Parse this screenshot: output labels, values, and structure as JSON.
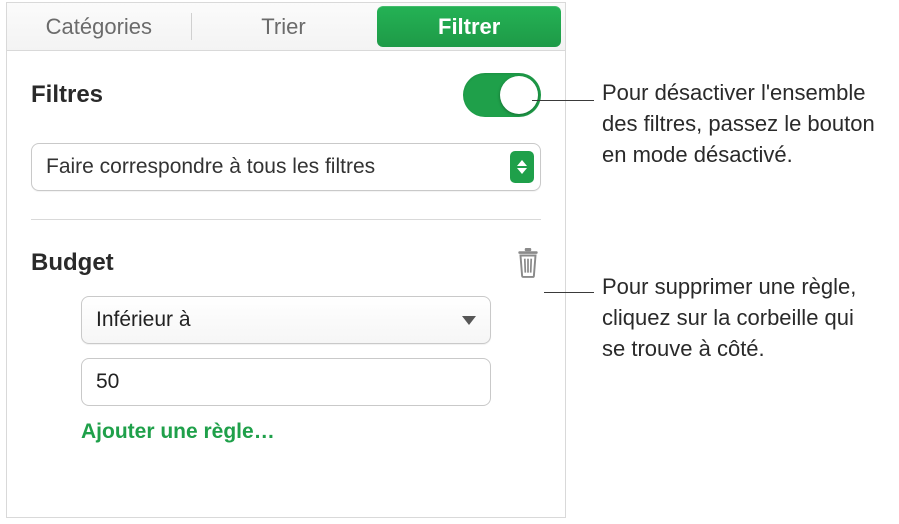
{
  "tabs": {
    "categories": "Catégories",
    "sort": "Trier",
    "filter": "Filtrer"
  },
  "filters": {
    "title": "Filtres",
    "match_mode": "Faire correspondre à tous les filtres"
  },
  "rule": {
    "column_label": "Budget",
    "operator": "Inférieur à",
    "value": "50",
    "add_rule": "Ajouter une règle…"
  },
  "callouts": {
    "toggle_off": "Pour désactiver l'ensemble des filtres, passez le bouton en mode désactivé.",
    "delete_rule": "Pour supprimer une règle, cliquez sur la corbeille qui se trouve à côté."
  }
}
